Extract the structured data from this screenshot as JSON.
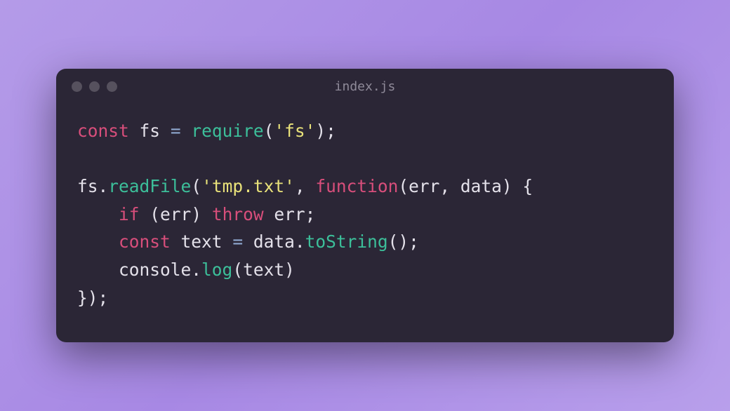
{
  "window": {
    "title": "index.js"
  },
  "code": {
    "raw": "const fs = require('fs');\n\nfs.readFile('tmp.txt', function(err, data) {\n    if (err) throw err;\n    const text = data.toString();\n    console.log(text)\n});",
    "tokens": [
      [
        [
          "kw",
          "const"
        ],
        [
          "pn",
          " "
        ],
        [
          "id",
          "fs"
        ],
        [
          "pn",
          " "
        ],
        [
          "op",
          "="
        ],
        [
          "pn",
          " "
        ],
        [
          "fn",
          "require"
        ],
        [
          "pn",
          "("
        ],
        [
          "str",
          "'fs'"
        ],
        [
          "pn",
          ");"
        ]
      ],
      [],
      [
        [
          "id",
          "fs"
        ],
        [
          "pn",
          "."
        ],
        [
          "fn",
          "readFile"
        ],
        [
          "pn",
          "("
        ],
        [
          "str",
          "'tmp.txt'"
        ],
        [
          "pn",
          ", "
        ],
        [
          "kw",
          "function"
        ],
        [
          "pn",
          "("
        ],
        [
          "id",
          "err"
        ],
        [
          "pn",
          ", "
        ],
        [
          "id",
          "data"
        ],
        [
          "pn",
          ") {"
        ]
      ],
      [
        [
          "pn",
          "    "
        ],
        [
          "kw",
          "if"
        ],
        [
          "pn",
          " ("
        ],
        [
          "id",
          "err"
        ],
        [
          "pn",
          ") "
        ],
        [
          "kw",
          "throw"
        ],
        [
          "pn",
          " "
        ],
        [
          "id",
          "err"
        ],
        [
          "pn",
          ";"
        ]
      ],
      [
        [
          "pn",
          "    "
        ],
        [
          "kw",
          "const"
        ],
        [
          "pn",
          " "
        ],
        [
          "id",
          "text"
        ],
        [
          "pn",
          " "
        ],
        [
          "op",
          "="
        ],
        [
          "pn",
          " "
        ],
        [
          "id",
          "data"
        ],
        [
          "pn",
          "."
        ],
        [
          "fn",
          "toString"
        ],
        [
          "pn",
          "();"
        ]
      ],
      [
        [
          "pn",
          "    "
        ],
        [
          "id",
          "console"
        ],
        [
          "pn",
          "."
        ],
        [
          "fn",
          "log"
        ],
        [
          "pn",
          "("
        ],
        [
          "id",
          "text"
        ],
        [
          "pn",
          ")"
        ]
      ],
      [
        [
          "pn",
          "});"
        ]
      ]
    ]
  }
}
